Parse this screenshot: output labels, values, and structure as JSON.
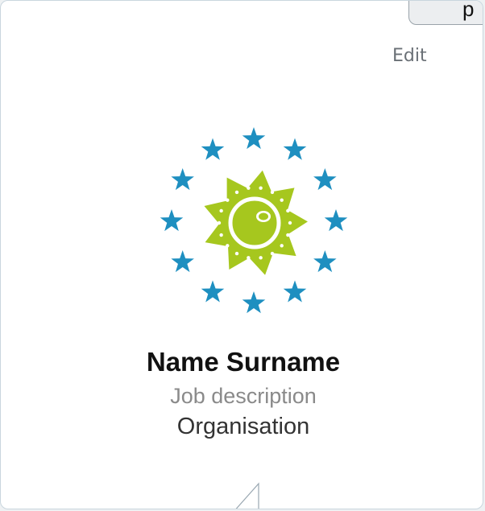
{
  "header": {
    "tab_label": "p",
    "edit_label": "Edit"
  },
  "profile": {
    "name": "Name Surname",
    "job_description": "Job description",
    "organisation": "Organisation"
  },
  "logo": {
    "icon": "eu-stars-sun-logo",
    "star_color": "#1e8fc0",
    "sun_color": "#a6c71e"
  }
}
